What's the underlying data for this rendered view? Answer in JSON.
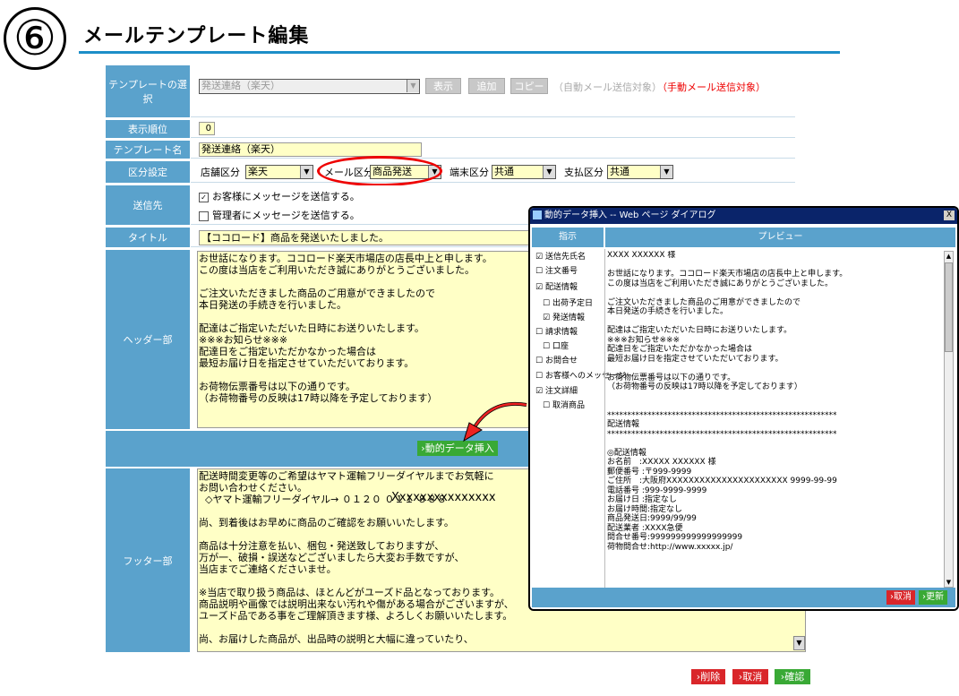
{
  "header": {
    "step_number": "⑥",
    "title": "メールテンプレート編集"
  },
  "template_select": {
    "label": "テンプレートの選択",
    "selected": "発送連絡（楽天）",
    "show_button": "表示",
    "add_button": "追加",
    "copy_button": "コピー",
    "auto_note": "（自動メール送信対象）",
    "manual_note": "（手動メール送信対象）"
  },
  "display_order": {
    "label": "表示順位",
    "value": "0"
  },
  "template_name": {
    "label": "テンプレート名",
    "value": "発送連絡（楽天）"
  },
  "category": {
    "label": "区分設定",
    "store_label": "店舗区分",
    "store_value": "楽天",
    "mail_label": "メール区分",
    "mail_value": "商品発送",
    "device_label": "端末区分",
    "device_value": "共通",
    "payment_label": "支払区分",
    "payment_value": "共通"
  },
  "recipient": {
    "label": "送信先",
    "customer": "お客様にメッセージを送信する。",
    "admin": "管理者にメッセージを送信する。"
  },
  "title_row": {
    "label": "タイトル",
    "value": "【ココロード】商品を発送いたしました。"
  },
  "header_part": {
    "label": "ヘッダー部",
    "body": "お世話になります。ココロード楽天市場店の店長中上と申します。\nこの度は当店をご利用いただき誠にありがとうございました。\n\nご注文いただきました商品のご用意ができましたので\n本日発送の手続きを行いました。\n\n配達はご指定いただいた日時にお送りいたします。\n※※※お知らせ※※※\n配達日をご指定いただかなかった場合は\n最短お届け日を指定させていただいております。\n\nお荷物伝票番号は以下の通りです。\n（お荷物番号の反映は17時以降を予定しております）"
  },
  "dynamic_button": "›動的データ挿入",
  "footer_part": {
    "label": "フッター部",
    "body": "配送時間変更等のご希望はヤマト運輸フリーダイヤルまでお気軽に\nお問い合わせください。\n  ◇ヤマト運輸フリーダイヤル→ ０１２０ ０１１ ８８８\n\n尚、到着後はお早めに商品のご確認をお願いいたします。\n\n商品は十分注意を払い、梱包・発送致しておりますが、\n万が一、破損・誤送などございましたら大変お手数ですが、\n当店までご連絡くださいませ。\n\n※当店で取り扱う商品は、ほとんどがユーズド品となっております。\n商品説明や画像では説明出来ない汚れや傷がある場合がございますが、\nユーズド品である事をご理解頂きます様、よろしくお願いいたします。\n\n尚、お届けした商品が、出品時の説明と大幅に違っていたり、",
    "overlay": "Xxxxxxxxxxxxxxx"
  },
  "bottom_actions": {
    "delete": "›削除",
    "cancel": "›取消",
    "confirm": "›確認"
  },
  "dialog": {
    "title": "動的データ挿入 -- Web ページ ダイアログ",
    "close": "X",
    "col_directive": "指示",
    "col_preview": "プレビュー",
    "items": [
      {
        "label": "送信先氏名",
        "checked": "☑"
      },
      {
        "label": "注文番号",
        "checked": "☐"
      },
      {
        "label": "配送情報",
        "checked": "☑"
      },
      {
        "label": "出荷予定日",
        "checked": "☐"
      },
      {
        "label": "発送情報",
        "checked": "☑"
      },
      {
        "label": "請求情報",
        "checked": "☐"
      },
      {
        "label": "口座",
        "checked": "☐"
      },
      {
        "label": "お問合せ",
        "checked": "☐"
      },
      {
        "label": "お客様へのメッセージ",
        "checked": "☐"
      },
      {
        "label": "注文詳細",
        "checked": "☑"
      },
      {
        "label": "取消商品",
        "checked": "☐"
      }
    ],
    "preview": "XXXX XXXXXX 様\n\nお世話になります。ココロード楽天市場店の店長中上と申します。\nこの度は当店をご利用いただき誠にありがとうございました。\n\nご注文いただきました商品のご用意ができましたので\n本日発送の手続きを行いました。\n\n配達はご指定いただいた日時にお送りいたします。\n※※※お知らせ※※※\n配達日をご指定いただかなかった場合は\n最短お届け日を指定させていただいております。\n\nお荷物伝票番号は以下の通りです。\n（お荷物番号の反映は17時以降を予定しております）\n\n\n*********************************************************\n配送情報\n*********************************************************\n\n◎配送情報\nお名前　:XXXXX XXXXXX 様\n郵便番号 :〒999-9999\nご住所　:大阪府XXXXXXXXXXXXXXXXXXXXXX 9999-99-99\n電話番号 :999-9999-9999\nお届け日 :指定なし\nお届け時間:指定なし\n商品発送日:9999/99/99\n配送業者 :XXXX急便\n問合せ番号:999999999999999999\n荷物問合せ:http://www.xxxxx.jp/",
    "cancel": "›取消",
    "update": "›更新"
  }
}
